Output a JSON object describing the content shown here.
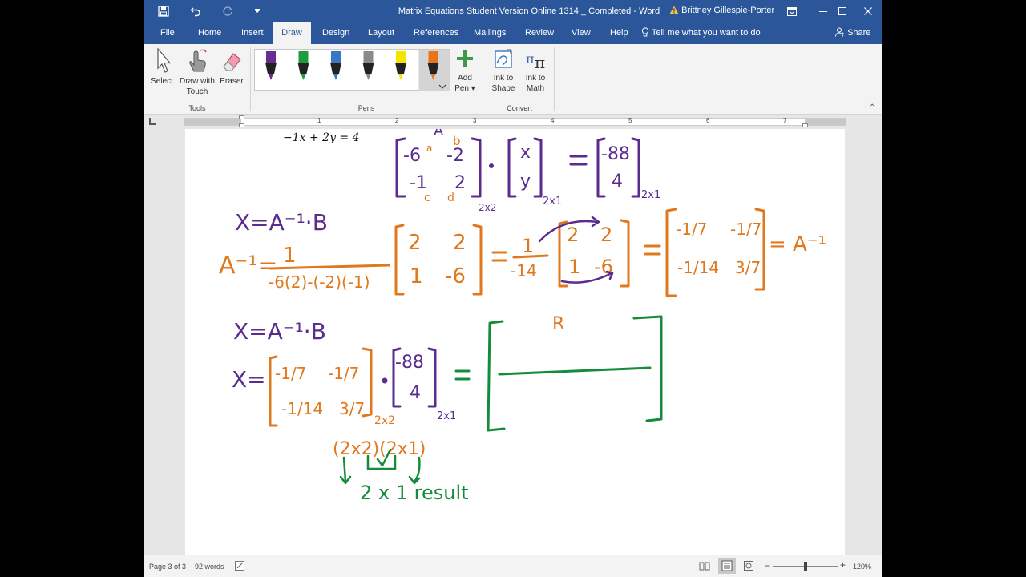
{
  "titlebar": {
    "document_title": "Matrix Equations Student Version Online 1314 _ Completed  -  Word",
    "user_name": "Brittney Gillespie-Porter"
  },
  "menu": {
    "tabs": [
      "File",
      "Home",
      "Insert",
      "Draw",
      "Design",
      "Layout",
      "References",
      "Mailings",
      "Review",
      "View",
      "Help"
    ],
    "active_tab": "Draw",
    "tell_me": "Tell me what you want to do",
    "share": "Share"
  },
  "ribbon": {
    "tools": {
      "select": "Select",
      "draw_touch_1": "Draw with",
      "draw_touch_2": "Touch",
      "eraser": "Eraser",
      "group": "Tools"
    },
    "pens": {
      "group": "Pens",
      "add_pen_1": "Add",
      "add_pen_2": "Pen",
      "colors": [
        "#6a2c91",
        "#1e9b3c",
        "#3a78c3",
        "#8a8a8a",
        "#f5e400",
        "#e8751a"
      ]
    },
    "convert": {
      "ink_shape_1": "Ink to",
      "ink_shape_2": "Shape",
      "ink_math_1": "Ink to",
      "ink_math_2": "Math",
      "group": "Convert"
    }
  },
  "ruler": {
    "numbers": [
      "1",
      "2",
      "3",
      "4",
      "5",
      "6",
      "7"
    ]
  },
  "document": {
    "equation_line": "−1x + 2y = 4",
    "handwriting": {
      "label_A": "A",
      "label_b_top": "b",
      "label_a": "a",
      "label_c": "c",
      "label_d": "d",
      "mA": [
        "-6",
        "-2",
        "-1",
        "2"
      ],
      "mX": [
        "x",
        "y"
      ],
      "mB": [
        "-88",
        "4"
      ],
      "dim_2x2": "2x2",
      "dim_2x1": "2x1",
      "eq1": "X=A⁻¹·B",
      "ainv_lhs": "A⁻¹=",
      "ainv_num": "1",
      "ainv_den": "-6(2)-(-2)(-1)",
      "adj": [
        "2",
        "2",
        "1",
        "-6"
      ],
      "frac_num": "1",
      "frac_den": "-14",
      "adj2": [
        "2",
        "2",
        "1",
        "-6"
      ],
      "inv": [
        "-1/7",
        "-1/7",
        "-1/14",
        "3/7"
      ],
      "inv_rhs": "= A⁻¹",
      "eq2": "X=A⁻¹·B",
      "x_eq": "X=",
      "inv_b": [
        "-1/7",
        "-1/7",
        "-1/14",
        "3/7"
      ],
      "result_r": "R",
      "dims_row": "(2x2)(2x1)",
      "result_text": "2 x 1  result"
    }
  },
  "status": {
    "page": "Page 3 of 3",
    "words": "92 words",
    "zoom": "120%"
  }
}
